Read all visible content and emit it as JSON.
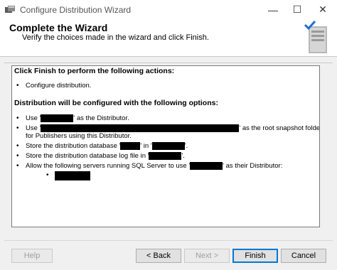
{
  "window": {
    "title": "Configure Distribution Wizard",
    "controls": {
      "minimize": "—",
      "maximize": "☐",
      "close": "✕"
    }
  },
  "header": {
    "title": "Complete the Wizard",
    "subtitle": "Verify the choices made in the wizard and click Finish."
  },
  "report": {
    "heading1": "Click Finish to perform the following actions:",
    "actions": [
      "Configure distribution."
    ],
    "heading2": "Distribution will be configured with the following options:",
    "options": {
      "use_prefix": "Use '",
      "use_suffix": "' as the Distributor.",
      "snapshot_prefix": "Use '",
      "snapshot_suffix": "' as the root snapshot folder",
      "snapshot_cont": "for Publishers using this Distributor.",
      "db_prefix": "Store the distribution database '",
      "db_mid": "' in '",
      "db_suffix": "'.",
      "log_prefix": "Store the distribution database log file in '",
      "log_suffix": "'.",
      "allow_prefix": "Allow the following servers running SQL Server to use '",
      "allow_suffix": "' as their Distributor:"
    },
    "bullet": "•",
    "sub_bullet": "•"
  },
  "buttons": {
    "help": "Help",
    "back": "< Back",
    "next": "Next >",
    "finish": "Finish",
    "cancel": "Cancel"
  }
}
